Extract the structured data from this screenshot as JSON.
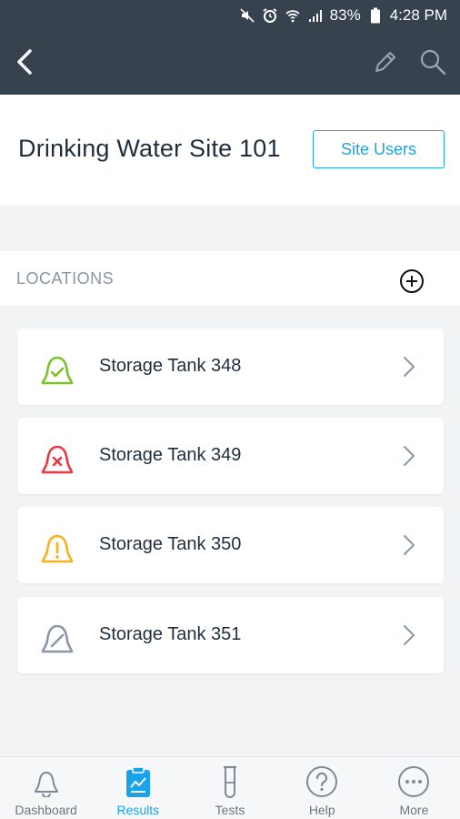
{
  "status_bar": {
    "battery": "83%",
    "time": "4:28 PM"
  },
  "toolbar": {
    "back_icon": "chevron-left-icon",
    "edit_icon": "pencil-icon",
    "search_icon": "search-icon"
  },
  "site": {
    "title": "Drinking Water Site 101",
    "users_button": "Site Users"
  },
  "locations": {
    "header": "LOCATIONS",
    "items": [
      {
        "name": "Storage Tank 348",
        "status": "ok",
        "color": "#7cc12a"
      },
      {
        "name": "Storage Tank 349",
        "status": "error",
        "color": "#e63946"
      },
      {
        "name": "Storage Tank 350",
        "status": "warning",
        "color": "#f5b21b"
      },
      {
        "name": "Storage Tank 351",
        "status": "muted",
        "color": "#8a97a6"
      }
    ]
  },
  "bottom_nav": {
    "items": [
      {
        "label": "Dashboard",
        "icon": "bell-icon",
        "active": false
      },
      {
        "label": "Results",
        "icon": "clipboard-chart-icon",
        "active": true
      },
      {
        "label": "Tests",
        "icon": "test-tube-icon",
        "active": false
      },
      {
        "label": "Help",
        "icon": "help-circle-icon",
        "active": false
      },
      {
        "label": "More",
        "icon": "more-dots-icon",
        "active": false
      }
    ]
  },
  "colors": {
    "toolbar": "#37424f",
    "accent": "#1aa3e8"
  }
}
